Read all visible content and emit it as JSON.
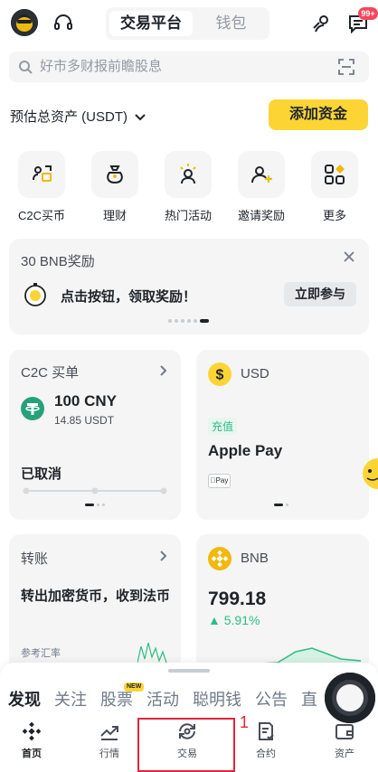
{
  "header": {
    "segments": {
      "active": "交易平台",
      "inactive": "钱包"
    },
    "notification_badge": "99+"
  },
  "search": {
    "placeholder": "好市多财报前瞻股息"
  },
  "assets": {
    "label": "预估总资产 (USDT)",
    "add_funds": "添加资金"
  },
  "shortcuts": [
    {
      "label": "C2C买币",
      "icon": "c2c-icon"
    },
    {
      "label": "理财",
      "icon": "moneybag-icon"
    },
    {
      "label": "热门活动",
      "icon": "hot-activity-icon"
    },
    {
      "label": "邀请奖励",
      "icon": "invite-icon"
    },
    {
      "label": "更多",
      "icon": "more-grid-icon"
    }
  ],
  "reward": {
    "title": "30 BNB奖励",
    "message": "点击按钮，领取奖励！",
    "join": "立即参与",
    "pages": 6,
    "active_page": 6
  },
  "c2c_card": {
    "title": "C2C 买单",
    "amount": "100 CNY",
    "usdt": "14.85 USDT",
    "status": "已取消"
  },
  "usd_card": {
    "currency": "USD",
    "tag": "充值",
    "method": "Apple Pay",
    "pay_badge": "Pay"
  },
  "transfer_card": {
    "title": "转账",
    "desc": "转出加密货币，收到法币",
    "rate_label": "参考汇率"
  },
  "bnb_card": {
    "symbol": "BNB",
    "price": "799.18",
    "change": "▲ 5.91%"
  },
  "feed_tabs": [
    {
      "label": "发现",
      "active": true
    },
    {
      "label": "关注",
      "active": false
    },
    {
      "label": "股票",
      "active": false,
      "badge": "NEW"
    },
    {
      "label": "活动",
      "active": false
    },
    {
      "label": "聪明钱",
      "active": false
    },
    {
      "label": "公告",
      "active": false
    },
    {
      "label": "直",
      "active": false
    }
  ],
  "bottom_nav": [
    {
      "label": "首页",
      "icon": "binance-logo-icon",
      "active": true
    },
    {
      "label": "行情",
      "icon": "market-chart-icon",
      "active": false
    },
    {
      "label": "交易",
      "icon": "trade-swap-icon",
      "active": false
    },
    {
      "label": "合约",
      "icon": "futures-icon",
      "active": false
    },
    {
      "label": "资产",
      "icon": "wallet-icon",
      "active": false
    }
  ],
  "annotation": {
    "number": "1"
  },
  "colors": {
    "brand_yellow": "#fcd535",
    "up_green": "#2ebd85",
    "text_primary": "#1e2329",
    "highlight_red": "#e0263c"
  }
}
